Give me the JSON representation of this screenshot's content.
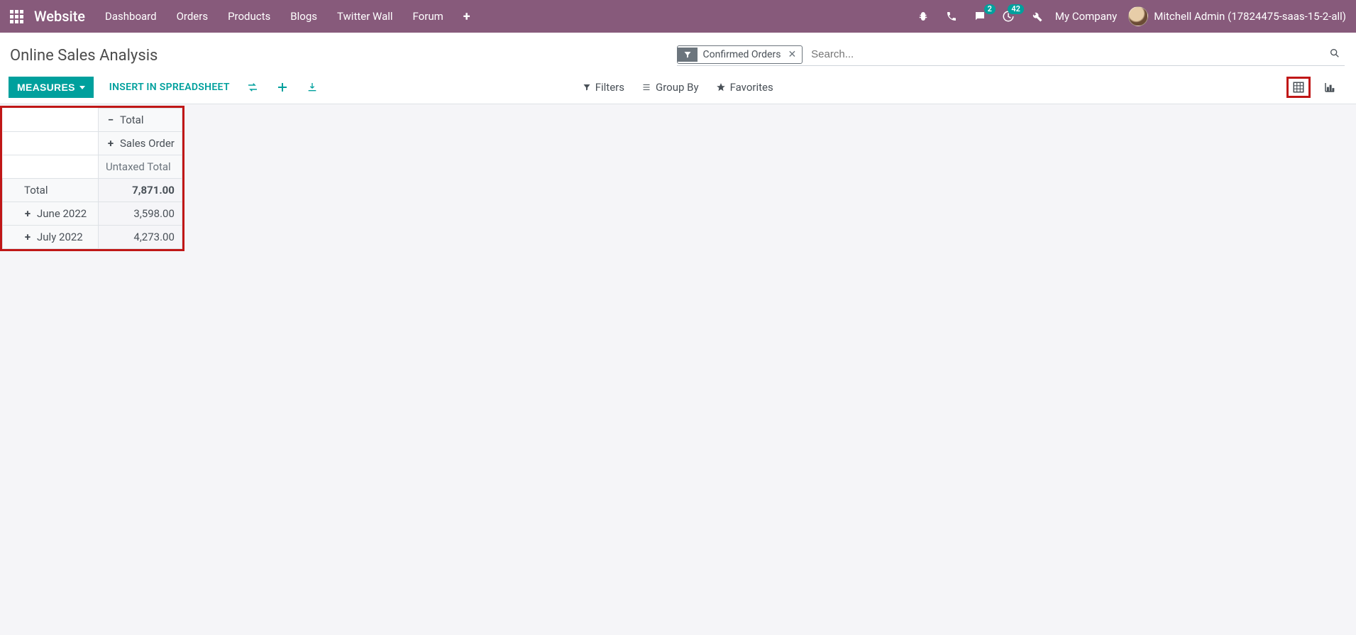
{
  "nav": {
    "brand": "Website",
    "links": [
      "Dashboard",
      "Orders",
      "Products",
      "Blogs",
      "Twitter Wall",
      "Forum"
    ],
    "messages_badge": "2",
    "activities_badge": "42",
    "company": "My Company",
    "user": "Mitchell Admin (17824475-saas-15-2-all)"
  },
  "page": {
    "title": "Online Sales Analysis"
  },
  "search": {
    "chip_label": "Confirmed Orders",
    "placeholder": "Search..."
  },
  "toolbar": {
    "measures": "MEASURES",
    "insert": "INSERT IN SPREADSHEET",
    "filters": "Filters",
    "groupby": "Group By",
    "favorites": "Favorites"
  },
  "pivot": {
    "col_total": "Total",
    "col_group": "Sales Order",
    "measure": "Untaxed Total",
    "rows": [
      {
        "label": "Total",
        "value": "7,871.00",
        "bold": true,
        "collapse": false
      },
      {
        "label": "June 2022",
        "value": "3,598.00",
        "indent": true
      },
      {
        "label": "July 2022",
        "value": "4,273.00",
        "indent": true
      }
    ]
  },
  "chart_data": {
    "type": "table",
    "title": "Online Sales Analysis — Untaxed Total by Order Date: Month",
    "categories": [
      "June 2022",
      "July 2022"
    ],
    "values": [
      3598.0,
      4273.0
    ],
    "total": 7871.0,
    "measure": "Untaxed Total",
    "column_group": "Sales Order"
  }
}
